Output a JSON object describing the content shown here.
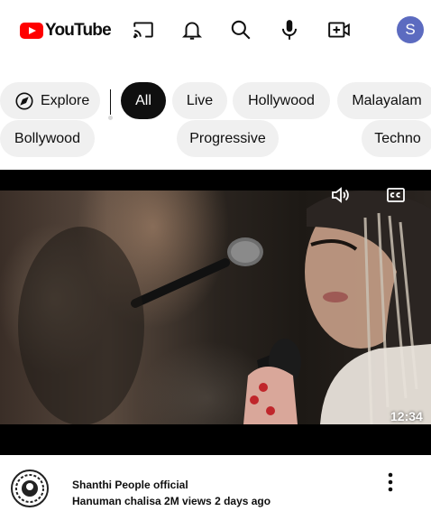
{
  "header": {
    "logo_text": "YouTube",
    "avatar_letter": "S",
    "icons": [
      "cast-icon",
      "bell-icon",
      "search-icon",
      "mic-icon",
      "create-video-icon"
    ]
  },
  "chips": {
    "explore": "Explore",
    "all": "All",
    "live": "Live",
    "hollywood": "Hollywood",
    "malayalam": "Malayalam",
    "bollywood": "Bollywood",
    "progressive": "Progressive",
    "techno": "Techno"
  },
  "video": {
    "duration": "12:34",
    "controls": [
      "mute-icon",
      "captions-icon"
    ]
  },
  "meta": {
    "channel": "Shanthi People official",
    "details": "Hanuman chalisa 2M views 2 days ago"
  },
  "colors": {
    "brand": "#ff0000",
    "avatar": "#5c6bc0",
    "chip_bg": "#f0f0f0",
    "chip_active": "#0f0f0f"
  }
}
